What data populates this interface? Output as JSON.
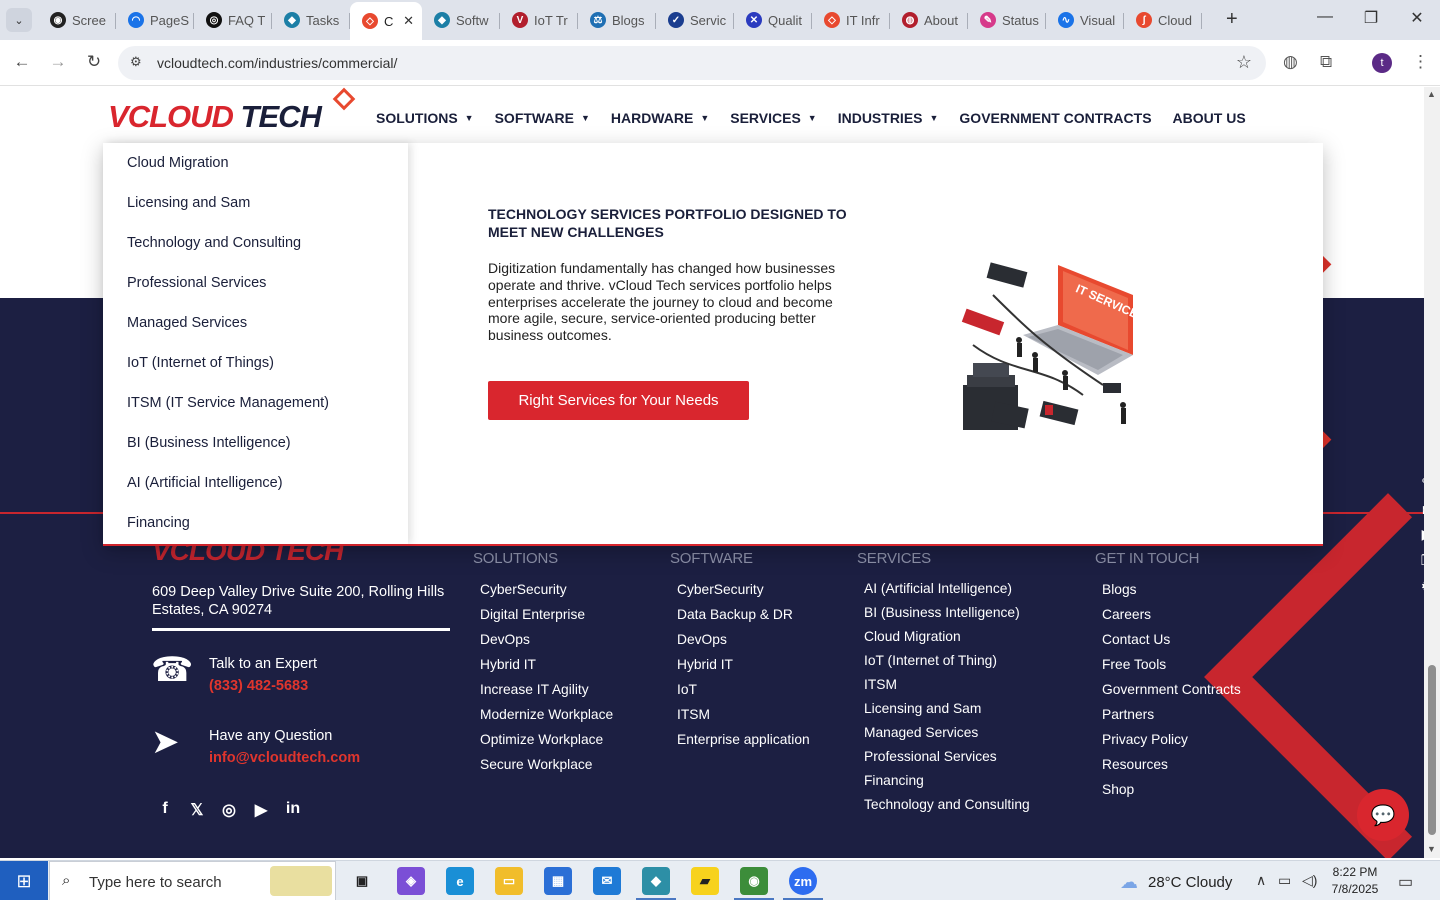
{
  "browser": {
    "tabs": [
      {
        "label": "Scree",
        "color": "#222222",
        "glyph": "◉"
      },
      {
        "label": "PageS",
        "color": "#1a73e8",
        "glyph": "◠"
      },
      {
        "label": "FAQ T",
        "color": "#111111",
        "glyph": "◎"
      },
      {
        "label": "Tasks",
        "color": "#1c7fa6",
        "glyph": "◆"
      },
      {
        "label": "C",
        "color": "#e8492f",
        "glyph": "◇"
      },
      {
        "label": "Softw",
        "color": "#1c7fa6",
        "glyph": "◆"
      },
      {
        "label": "IoT Tr",
        "color": "#b21f2d",
        "glyph": "V"
      },
      {
        "label": "Blogs",
        "color": "#1f6fb3",
        "glyph": "⚖"
      },
      {
        "label": "Servic",
        "color": "#1a3d8f",
        "glyph": "✓"
      },
      {
        "label": "Qualit",
        "color": "#2b3bbf",
        "glyph": "✕"
      },
      {
        "label": "IT Infr",
        "color": "#e8492f",
        "glyph": "◇"
      },
      {
        "label": "About",
        "color": "#b21f2d",
        "glyph": "◍"
      },
      {
        "label": "Status",
        "color": "#d63a8a",
        "glyph": "✎"
      },
      {
        "label": "Visual",
        "color": "#1a73e8",
        "glyph": "∿"
      },
      {
        "label": "Cloud",
        "color": "#e8492f",
        "glyph": "ʃ"
      }
    ],
    "url": "vcloudtech.com/industries/commercial/",
    "profile_initial": "t"
  },
  "site": {
    "logo": {
      "v": "V",
      "cloud": "CLOUD",
      "tech": " TECH"
    },
    "menu": [
      {
        "label": "SOLUTIONS",
        "caret": true
      },
      {
        "label": "SOFTWARE",
        "caret": true
      },
      {
        "label": "HARDWARE",
        "caret": true
      },
      {
        "label": "SERVICES",
        "caret": true
      },
      {
        "label": "INDUSTRIES",
        "caret": true
      },
      {
        "label": "GOVERNMENT CONTRACTS",
        "caret": false
      },
      {
        "label": "ABOUT US",
        "caret": false
      }
    ]
  },
  "mega_menu": {
    "items": [
      "Cloud Migration",
      "Licensing and Sam",
      "Technology and Consulting",
      "Professional Services",
      "Managed Services",
      "IoT (Internet of Things)",
      "ITSM (IT Service Management)",
      "BI  (Business Intelligence)",
      "AI  (Artificial Intelligence)",
      "Financing"
    ],
    "title": "TECHNOLOGY SERVICES PORTFOLIO DESIGNED TO MEET NEW CHALLENGES",
    "body": "Digitization fundamentally has changed how businesses operate and thrive. vCloud Tech services portfolio helps enterprises accelerate the journey to cloud and become more agile, secure, service-oriented producing better business outcomes.",
    "cta": "Right Services for Your Needs",
    "illustration_sign": "IT SERVICE"
  },
  "footer": {
    "logo_text": "VCLOUD TECH",
    "address": "609 Deep Valley Drive Suite 200, Rolling Hills Estates, CA 90274",
    "talk_label": "Talk to an Expert",
    "phone": "(833) 482-5683",
    "question_label": "Have any Question",
    "email": "info@vcloudtech.com",
    "social": [
      "f",
      "X",
      "ig",
      "yt",
      "in"
    ],
    "columns": [
      {
        "head": "SOLUTIONS",
        "links": [
          "CyberSecurity",
          "Digital Enterprise",
          "DevOps",
          "Hybrid IT",
          "Increase IT Agility",
          "Modernize Workplace",
          "Optimize Workplace",
          "Secure Workplace"
        ]
      },
      {
        "head": "SOFTWARE",
        "links": [
          "CyberSecurity",
          "Data Backup & DR",
          "DevOps",
          "Hybrid IT",
          "IoT",
          "ITSM",
          "Enterprise application"
        ]
      },
      {
        "head": "SERVICES",
        "links": [
          "AI (Artificial Intelligence)",
          "BI (Business Intelligence)",
          "Cloud Migration",
          "IoT (Internet of Thing)",
          "ITSM",
          "Licensing and Sam",
          "Managed Services",
          "Professional Services",
          "Financing",
          "Technology and Consulting"
        ]
      },
      {
        "head": "GET IN TOUCH",
        "links": [
          "Blogs",
          "Careers",
          "Contact Us",
          "Free Tools",
          "Government Contracts",
          "Partners",
          "Privacy Policy",
          "Resources",
          "Shop"
        ]
      }
    ]
  },
  "taskbar": {
    "search_placeholder": "Type here to search",
    "weather": "28°C  Cloudy",
    "time": "8:22 PM",
    "date": "7/8/2025"
  },
  "colors": {
    "brand_red": "#d9262e",
    "navy": "#1c1f42"
  }
}
